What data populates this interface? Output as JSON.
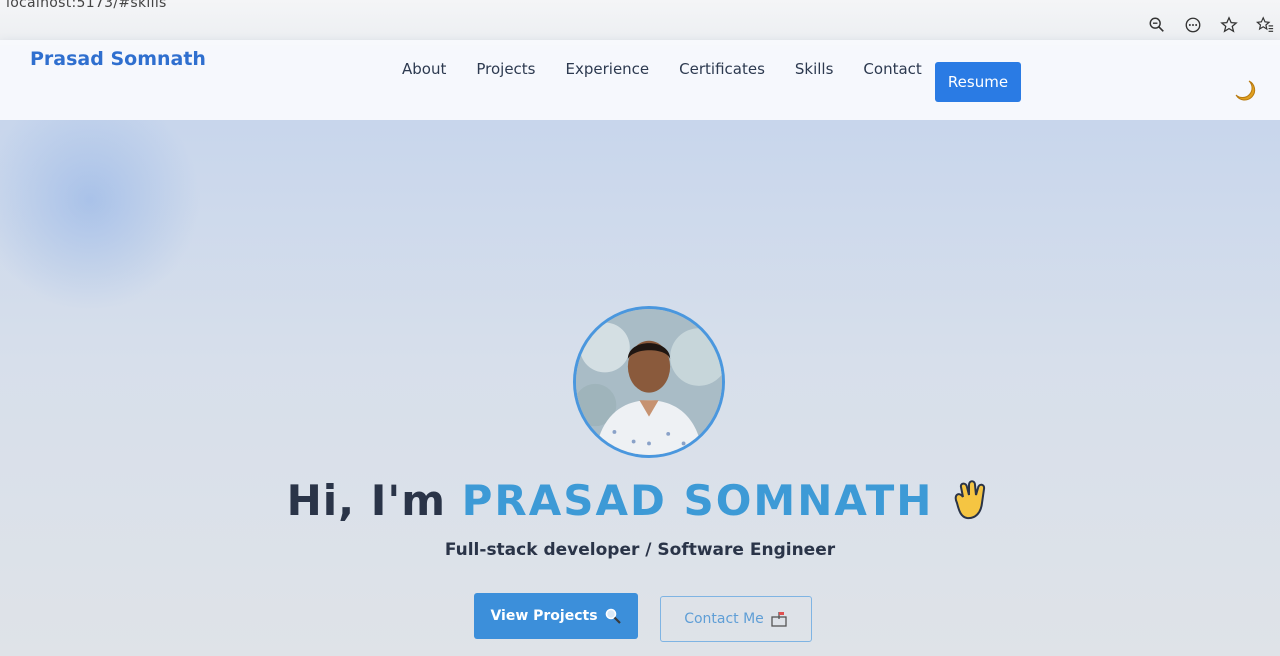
{
  "browser": {
    "url": "localhost:5173/#skills",
    "icons": [
      "zoom-out-icon",
      "more-icon",
      "bookmark-star-icon",
      "favorites-icon"
    ]
  },
  "navbar": {
    "brand": "Prasad Somnath",
    "links": [
      "About",
      "Projects",
      "Experience",
      "Certificates",
      "Skills",
      "Contact"
    ],
    "resume_label": "Resume",
    "theme_icon": "moon-icon"
  },
  "hero": {
    "greeting": "Hi, I'm",
    "name": "PRASAD SOMNATH",
    "wave_icon": "waving-hand-icon",
    "subtitle": "Full-stack developer / Software Engineer",
    "primary_button": "View Projects",
    "primary_icon": "magnifier-icon",
    "secondary_button": "Contact Me",
    "secondary_icon": "mailbox-icon"
  },
  "colors": {
    "brand": "#2f6fcf",
    "accent_button": "#2a7be4",
    "name_highlight": "#3d9ad6",
    "text_dark": "#2a3448"
  }
}
